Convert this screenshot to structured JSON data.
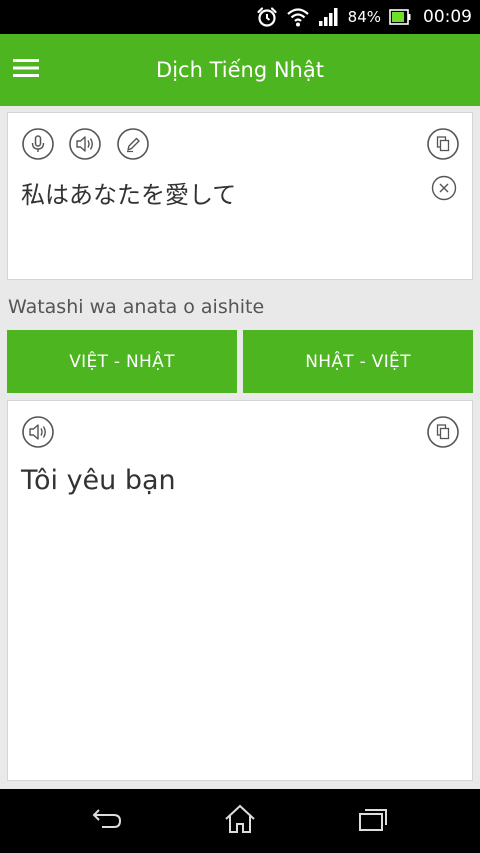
{
  "status_bar": {
    "battery_percent": "84%",
    "time": "00:09",
    "icons": [
      "alarm-icon",
      "wifi-icon",
      "signal-icon",
      "battery-icon"
    ]
  },
  "app_bar": {
    "title": "Dịch Tiếng Nhật",
    "menu_icon": "hamburger-menu-icon"
  },
  "input_card": {
    "source_text": "私はあなたを愛して",
    "icons": [
      "microphone-icon",
      "speaker-icon",
      "pencil-icon",
      "copy-icon",
      "clear-icon"
    ]
  },
  "romaji": "Watashi wa anata o aishite",
  "direction_buttons": {
    "vi_ja": "VIỆT - NHẬT",
    "ja_vi": "NHẬT - VIỆT"
  },
  "output_card": {
    "result_text": "Tôi yêu bạn",
    "icons": [
      "speaker-icon",
      "copy-icon"
    ]
  },
  "nav_bar": {
    "icons": [
      "back-icon",
      "home-icon",
      "recent-apps-icon"
    ]
  },
  "colors": {
    "brand_green": "#4cb520",
    "background": "#e9e9e9",
    "text_dark": "#333333"
  }
}
